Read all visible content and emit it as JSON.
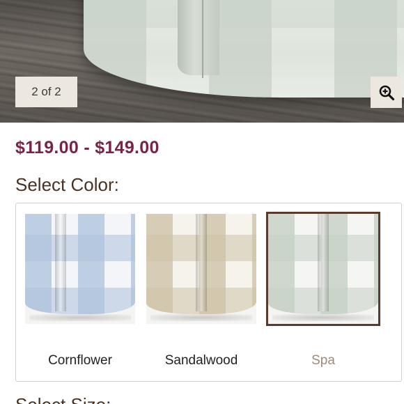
{
  "gallery": {
    "counter": "2 of 2"
  },
  "product": {
    "price_range": "$119.00 - $149.00"
  },
  "color_section": {
    "heading": "Select Color:",
    "swatches": [
      {
        "label": "Cornflower",
        "selected": false,
        "color_a": "#aec2dc",
        "color_b": "#f3f5f8"
      },
      {
        "label": "Sandalwood",
        "selected": false,
        "color_a": "#cfc3a8",
        "color_b": "#f6f3ec"
      },
      {
        "label": "Spa",
        "selected": true,
        "color_a": "#c6d0c5",
        "color_b": "#f5f6f3"
      }
    ]
  },
  "next_section": {
    "heading": "Select Size:"
  },
  "colors": {
    "price": "#7b2346",
    "heading": "#4a3222",
    "selected_border": "#5a3a2a"
  },
  "icons": {
    "zoom": "zoom-in-icon"
  }
}
